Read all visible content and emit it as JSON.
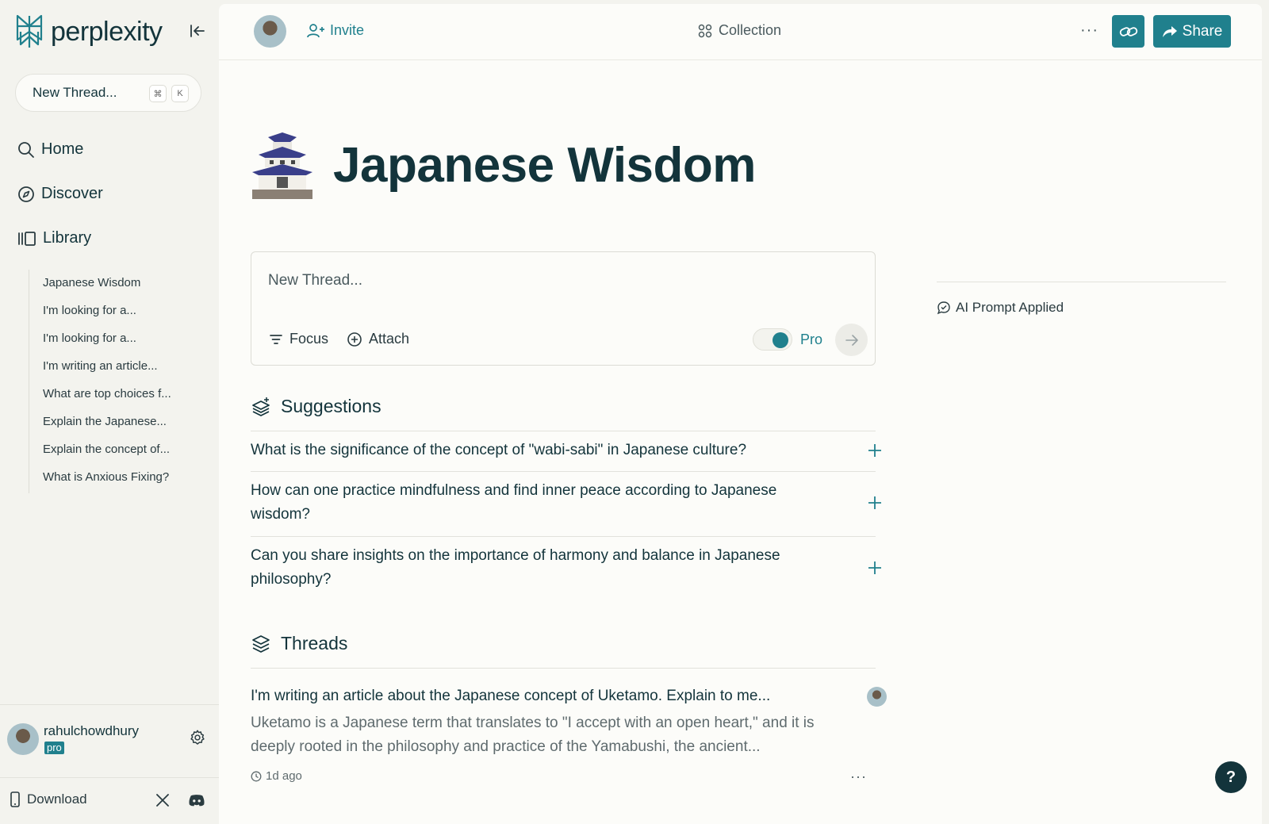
{
  "app": {
    "logo_text": "perplexity"
  },
  "sidebar": {
    "new_thread_label": "New Thread...",
    "shortcut_keys": [
      "⌘",
      "K"
    ],
    "nav": [
      {
        "label": "Home",
        "icon": "search-icon"
      },
      {
        "label": "Discover",
        "icon": "compass-icon"
      },
      {
        "label": "Library",
        "icon": "library-icon"
      }
    ],
    "library_items": [
      "Japanese Wisdom",
      "I'm looking for a...",
      "I'm looking for a...",
      "I'm writing an article...",
      "What are top choices f...",
      "Explain the Japanese...",
      "Explain the concept of...",
      "What is Anxious Fixing?"
    ],
    "user": {
      "name": "rahulchowdhury",
      "badge": "pro"
    },
    "download_label": "Download"
  },
  "topbar": {
    "invite_label": "Invite",
    "collection_label": "Collection",
    "more_label": "···",
    "share_label": "Share"
  },
  "collection": {
    "emoji": "🏯",
    "title": "Japanese Wisdom"
  },
  "composer": {
    "placeholder": "New Thread...",
    "focus_label": "Focus",
    "attach_label": "Attach",
    "pro_label": "Pro",
    "pro_enabled": true
  },
  "suggestions": {
    "heading": "Suggestions",
    "items": [
      "What is the significance of the concept of \"wabi-sabi\" in Japanese culture?",
      "How can one practice mindfulness and find inner peace according to Japanese wisdom?",
      "Can you share insights on the importance of harmony and balance in Japanese philosophy?"
    ]
  },
  "threads": {
    "heading": "Threads",
    "items": [
      {
        "title": "I'm writing an article about the Japanese concept of Uketamo. Explain to me...",
        "snippet": "Uketamo is a Japanese term that translates to \"I accept with an open heart,\" and it is deeply rooted in the philosophy and practice of the Yamabushi, the ancient...",
        "time": "1d ago",
        "more": "···"
      }
    ]
  },
  "right_panel": {
    "ai_prompt_label": "AI Prompt Applied"
  },
  "help_label": "?",
  "colors": {
    "accent": "#20808d",
    "text": "#13343b",
    "sidebar_bg": "#f3f3ee",
    "main_bg": "#fcfcf9"
  }
}
